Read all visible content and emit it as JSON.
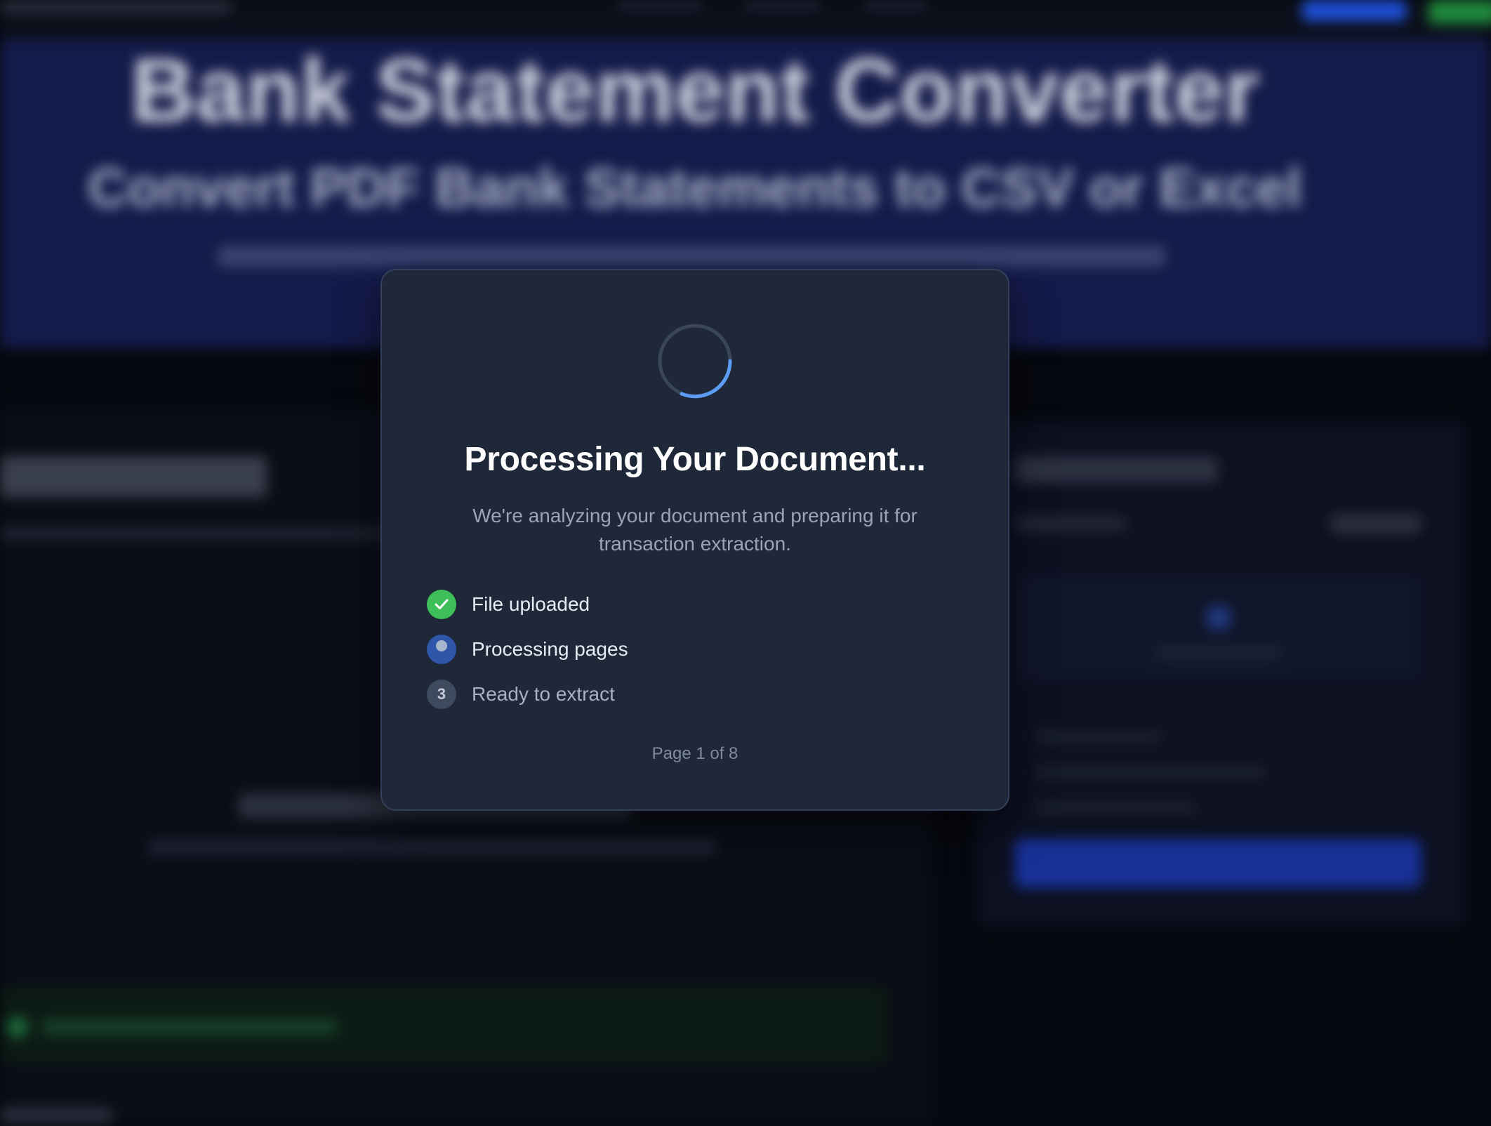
{
  "modal": {
    "title": "Processing Your Document...",
    "description": "We're analyzing your document and preparing it for transaction extraction.",
    "steps": [
      {
        "label": "File uploaded",
        "status": "done"
      },
      {
        "label": "Processing pages",
        "status": "active"
      },
      {
        "label": "Ready to extract",
        "status": "pending",
        "number": "3"
      }
    ],
    "page_indicator": "Page 1 of 8",
    "spinner_icon": "loading-spinner-icon",
    "colors": {
      "spinner_accent": "#5b9cf5",
      "done": "#3fbf5a",
      "active": "#2f56a8",
      "pending": "#3f4a5e",
      "modal_bg": "#1f2839"
    }
  },
  "background": {
    "hero": {
      "title": "Bank Statement Converter",
      "subtitle": "Convert PDF Bank Statements to CSV or Excel"
    },
    "colors": {
      "hero_bg": "#141b4a",
      "primary_button": "#1e4fd8",
      "secondary_button": "#1f8a3b"
    }
  }
}
